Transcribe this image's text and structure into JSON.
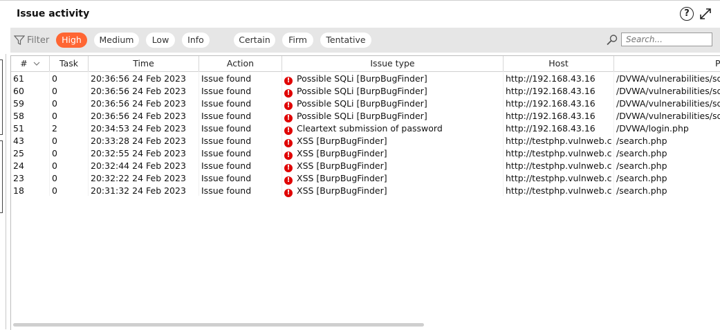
{
  "window": {
    "title": "Issue activity",
    "help_glyph": "?"
  },
  "filter": {
    "label": "Filter",
    "severity": [
      "High",
      "Medium",
      "Low",
      "Info"
    ],
    "active": "High",
    "confidence": [
      "Certain",
      "Firm",
      "Tentative"
    ],
    "search_placeholder": "Search..."
  },
  "table": {
    "headers": {
      "num": "#",
      "task": "Task",
      "time": "Time",
      "action": "Action",
      "issue": "Issue type",
      "host": "Host",
      "path": "P"
    },
    "rows": [
      {
        "num": "61",
        "task": "0",
        "time": "20:36:56 24 Feb 2023",
        "action": "Issue found",
        "issue": "Possible SQLi [BurpBugFinder]",
        "host": "http://192.168.43.16",
        "path": "/DVWA/vulnerabilities/sql"
      },
      {
        "num": "60",
        "task": "0",
        "time": "20:36:56 24 Feb 2023",
        "action": "Issue found",
        "issue": "Possible SQLi [BurpBugFinder]",
        "host": "http://192.168.43.16",
        "path": "/DVWA/vulnerabilities/sql"
      },
      {
        "num": "59",
        "task": "0",
        "time": "20:36:56 24 Feb 2023",
        "action": "Issue found",
        "issue": "Possible SQLi [BurpBugFinder]",
        "host": "http://192.168.43.16",
        "path": "/DVWA/vulnerabilities/sql"
      },
      {
        "num": "58",
        "task": "0",
        "time": "20:36:56 24 Feb 2023",
        "action": "Issue found",
        "issue": "Possible SQLi [BurpBugFinder]",
        "host": "http://192.168.43.16",
        "path": "/DVWA/vulnerabilities/sql"
      },
      {
        "num": "51",
        "task": "2",
        "time": "20:34:53 24 Feb 2023",
        "action": "Issue found",
        "issue": "Cleartext submission of password",
        "host": "http://192.168.43.16",
        "path": "/DVWA/login.php"
      },
      {
        "num": "43",
        "task": "0",
        "time": "20:33:28 24 Feb 2023",
        "action": "Issue found",
        "issue": "XSS [BurpBugFinder]",
        "host": "http://testphp.vulnweb.c...",
        "path": "/search.php"
      },
      {
        "num": "25",
        "task": "0",
        "time": "20:32:55 24 Feb 2023",
        "action": "Issue found",
        "issue": "XSS [BurpBugFinder]",
        "host": "http://testphp.vulnweb.c...",
        "path": "/search.php"
      },
      {
        "num": "24",
        "task": "0",
        "time": "20:32:44 24 Feb 2023",
        "action": "Issue found",
        "issue": "XSS [BurpBugFinder]",
        "host": "http://testphp.vulnweb.c...",
        "path": "/search.php"
      },
      {
        "num": "23",
        "task": "0",
        "time": "20:32:22 24 Feb 2023",
        "action": "Issue found",
        "issue": "XSS [BurpBugFinder]",
        "host": "http://testphp.vulnweb.c...",
        "path": "/search.php"
      },
      {
        "num": "18",
        "task": "0",
        "time": "20:31:32 24 Feb 2023",
        "action": "Issue found",
        "issue": "XSS [BurpBugFinder]",
        "host": "http://testphp.vulnweb.c...",
        "path": "/search.php"
      }
    ]
  },
  "colors": {
    "accent": "#ff6633",
    "high_severity": "#e00000"
  }
}
